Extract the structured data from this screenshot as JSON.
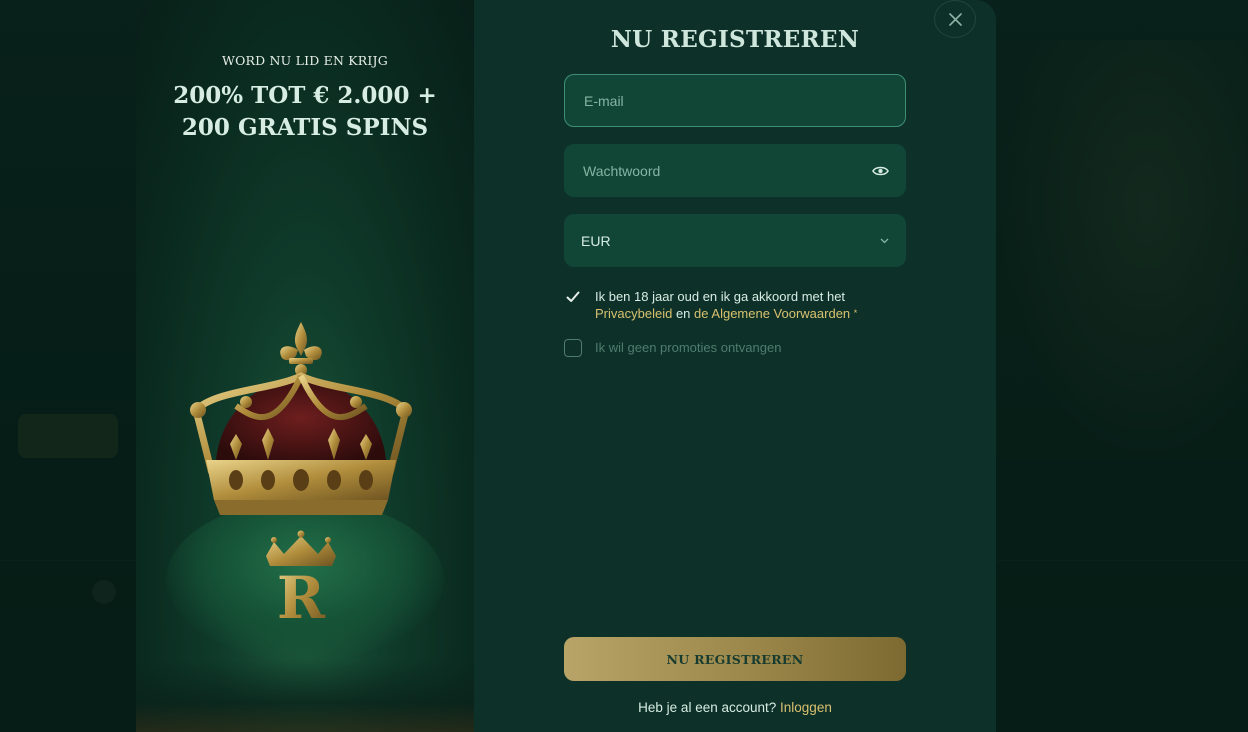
{
  "promo": {
    "eyebrow": "WORD NU LID EN KRIJG",
    "headline_line1": "200% TOT € 2.000 +",
    "headline_line2": "200 GRATIS SPINS",
    "logo_letter": "R"
  },
  "form": {
    "title": "NU REGISTREREN",
    "email_placeholder": "E-mail",
    "password_placeholder": "Wachtwoord",
    "currency_value": "EUR",
    "terms": {
      "checked": true,
      "text_before": "Ik ben 18 jaar oud en ik ga akkoord met het",
      "privacy_link": "Privacybeleid",
      "text_and": "en",
      "terms_link": "de Algemene Voorwaarden",
      "required_marker": "*"
    },
    "no_promotions": {
      "checked": false,
      "label": "Ik wil geen promoties ontvangen"
    },
    "submit_label": "NU REGISTREREN",
    "login_prompt": "Heb je al een account?",
    "login_link": "Inloggen"
  },
  "icons": {
    "close": "close-icon",
    "password_toggle": "eye-icon",
    "currency_dropdown": "chevron-down-icon",
    "checkbox": "checkmark-icon"
  },
  "colors": {
    "accent_gold": "#d8c070",
    "button_gold": "#b8a467",
    "field_bg": "#114637",
    "modal_bg": "#0d3128"
  }
}
